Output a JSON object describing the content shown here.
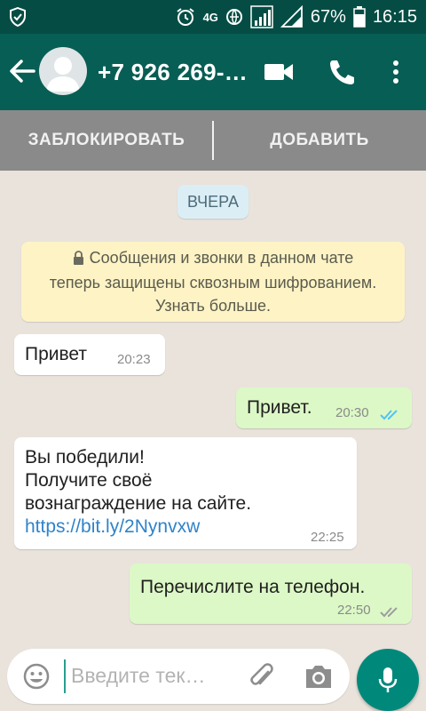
{
  "status_bar": {
    "network": "4G",
    "battery": "67%",
    "time": "16:15"
  },
  "header": {
    "contact": "+7 926 269-…"
  },
  "actions": {
    "block_label": "ЗАБЛОКИРОВАТЬ",
    "add_label": "ДОБАВИТЬ"
  },
  "chat": {
    "date_chip": "ВЧЕРА",
    "encryption_notice": {
      "line1": "Сообщения и звонки в данном чате",
      "line2": "теперь защищены сквозным шифрованием.",
      "line3": "Узнать больше."
    },
    "messages": [
      {
        "direction": "in",
        "text": "Привет",
        "time": "20:23"
      },
      {
        "direction": "out",
        "text": "Привет.",
        "time": "20:30",
        "ticks": "read"
      },
      {
        "direction": "in",
        "line1": "Вы победили!",
        "line2": "Получите своё",
        "line3": "вознаграждение на сайте.",
        "link": "https://bit.ly/2Nynvxw",
        "time": "22:25"
      },
      {
        "direction": "out",
        "text": "Перечислите на телефон.",
        "time": "22:50",
        "ticks": "delivered"
      }
    ]
  },
  "composer": {
    "placeholder": "Введите тек…"
  },
  "colors": {
    "header": "#075e54",
    "status_bar": "#054d44",
    "outgoing_bubble": "#dcf8c6",
    "incoming_bubble": "#ffffff",
    "read_ticks": "#4fc3f7",
    "fab": "#00897b"
  },
  "icons": [
    "shield-icon",
    "alarm-icon",
    "signal-icon",
    "battery-icon",
    "back-arrow-icon",
    "avatar-icon",
    "video-call-icon",
    "phone-icon",
    "more-vert-icon",
    "lock-icon",
    "double-check-icon",
    "emoji-icon",
    "attach-icon",
    "camera-icon",
    "mic-icon"
  ]
}
